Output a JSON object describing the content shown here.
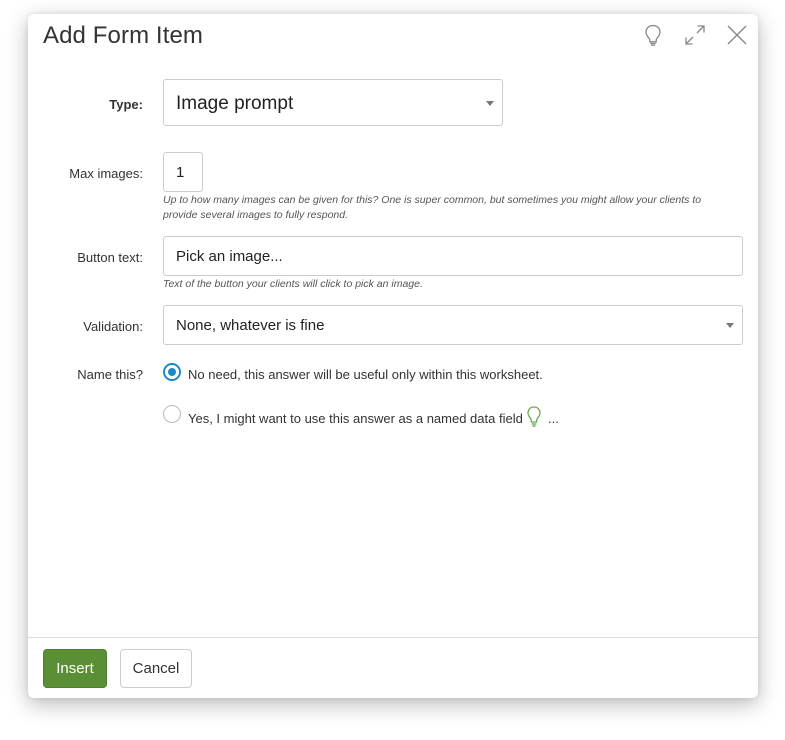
{
  "dialog": {
    "title": "Add Form Item",
    "icons": [
      "lightbulb-icon",
      "expand-icon",
      "close-icon"
    ]
  },
  "form": {
    "type": {
      "label": "Type:",
      "value": "Image prompt"
    },
    "max_images": {
      "label": "Max images:",
      "value": "1",
      "help": "Up to how many images can be given for this? One is super common, but sometimes you might allow your clients to provide several images to fully respond."
    },
    "button_text": {
      "label": "Button text:",
      "value": "Pick an image...",
      "help": "Text of the button your clients will click to pick an image."
    },
    "validation": {
      "label": "Validation:",
      "value": "None, whatever is fine"
    },
    "name_this": {
      "label": "Name this?",
      "options": [
        {
          "label": "No need, this answer will be useful only within this worksheet.",
          "selected": true
        },
        {
          "label": "Yes, I might want to use this answer as a named data field",
          "selected": false,
          "suffix": "..."
        }
      ]
    }
  },
  "footer": {
    "insert_label": "Insert",
    "cancel_label": "Cancel"
  },
  "colors": {
    "primary": "#5a8f35",
    "radio_selected": "#1e88c9",
    "lightbulb_green": "#6aa84f"
  }
}
